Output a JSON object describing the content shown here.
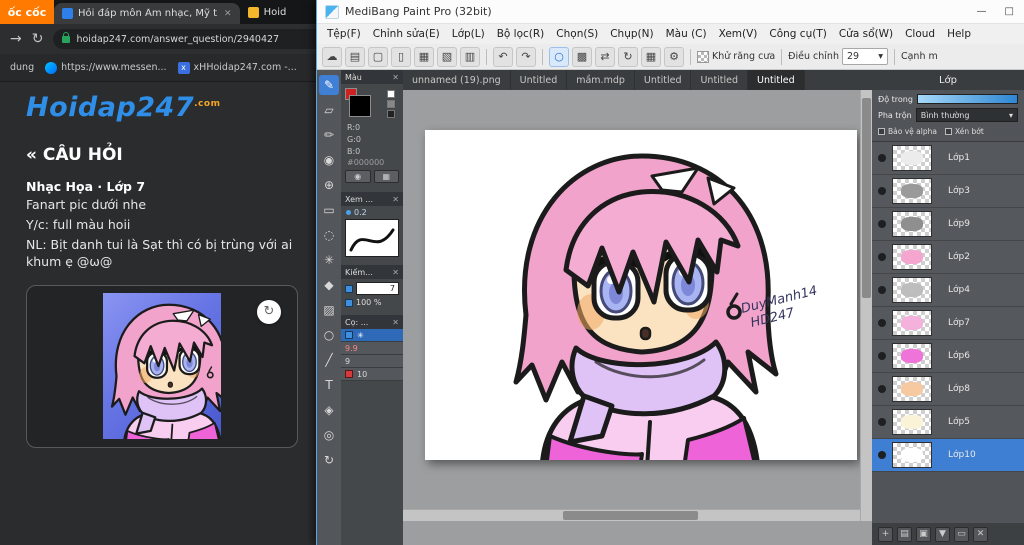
{
  "browser": {
    "brand": "ốc cốc",
    "tabs": [
      {
        "label": "Hỏi đáp môn Âm nhạc, Mỹ t"
      },
      {
        "label": "Hoid"
      }
    ],
    "nav": {
      "url": "hoidap247.com/answer_question/2940427"
    },
    "bookmarks": {
      "item1": "dung",
      "item2": "https://www.messen...",
      "item3": "xHHoidap247.com -..."
    },
    "site": {
      "logo": "Hoidap247",
      "logo_suffix": ".com",
      "heading": "« CÂU HỎI",
      "subject": "Nhạc Họa · Lớp 7",
      "lines": [
        "Fanart pic dưới nhe",
        "Y/c: full màu hoii",
        "NL: Bịt danh tui là Sạt thì có bị trùng với ai khum ẹ @ω@"
      ]
    },
    "icons": {
      "forward": "→",
      "reload": "↻",
      "close_tab": "✕",
      "refresh_image": "↻",
      "x_badge": "x"
    }
  },
  "medibang": {
    "title": "MediBang Paint Pro (32bit)",
    "window_controls": {
      "minimize": "—",
      "maximize": "□"
    },
    "menus": [
      "Tệp(F)",
      "Chỉnh sửa(E)",
      "Lớp(L)",
      "Bộ lọc(R)",
      "Chọn(S)",
      "Chụp(N)",
      "Màu (C)",
      "Xem(V)",
      "Công cụ(T)",
      "Cửa sổ(W)",
      "Cloud",
      "Help"
    ],
    "toolbar": {
      "antialias_label": "Khử răng cưa",
      "adjust_label": "Điều chỉnh",
      "adjust_value": "29",
      "dropdown_arrow": "▾",
      "edge_label": "Cạnh m"
    },
    "icons": {
      "cloud": "☁",
      "panel": "▤",
      "chat": "▢",
      "new_doc": "▯",
      "save": "▦",
      "open": "▧",
      "export": "▥",
      "undo": "↶",
      "redo": "↷",
      "select_circle": "○",
      "checker_mode": "▩",
      "flip": "⇄",
      "rotate": "↻",
      "grid": "▦",
      "gear": "⚙",
      "close": "✕"
    },
    "tool_icons": {
      "brush": "✎",
      "eraser": "▱",
      "pen": "✏",
      "dropper": "◉",
      "move": "⊕",
      "select_rect": "▭",
      "lasso": "◌",
      "wand": "✳",
      "bucket": "◆",
      "gradient": "▨",
      "shape": "○",
      "line": "╱",
      "text": "T",
      "hand": "◈",
      "zoom": "◎",
      "rotate_view": "↻"
    },
    "doc_tabs": [
      {
        "label": "unnamed (19).png"
      },
      {
        "label": "Untitled"
      },
      {
        "label": "mầm.mdp"
      },
      {
        "label": "Untitled"
      },
      {
        "label": "Untitled"
      },
      {
        "label": "Untitled"
      }
    ],
    "panels": {
      "color": {
        "title": "Màu",
        "r": "R:0",
        "g": "G:0",
        "b": "B:0",
        "hex": "#000000"
      },
      "preview": {
        "title": "Xem ...",
        "value": "0.2"
      },
      "size": {
        "title": "Kiếm...",
        "size_value": "7",
        "opacity_value": "100 %"
      },
      "brush": {
        "title": "Cọ: ...",
        "selected_glyph": "✳",
        "items": [
          "9.9",
          "9",
          "10"
        ]
      }
    },
    "layer_footer_icons": {
      "add": "+",
      "folder": "▤",
      "duplicate": "▣",
      "merge": "▼",
      "clear": "▭",
      "delete": "✕"
    },
    "layers_panel": {
      "title": "Lớp",
      "opacity_label": "Độ trong",
      "blend_label": "Pha trộn",
      "blend_value": "Bình thường",
      "alpha_protect_label": "Bảo vệ alpha",
      "clipping_label": "Xén bớt",
      "layers": [
        {
          "name": "Lớp1",
          "thumb": "#ececec"
        },
        {
          "name": "Lớp3",
          "thumb": "#9a9a9a"
        },
        {
          "name": "Lớp9",
          "thumb": "#8f8f8f"
        },
        {
          "name": "Lớp2",
          "thumb": "#f4a6cf"
        },
        {
          "name": "Lớp4",
          "thumb": "#bdbdbd"
        },
        {
          "name": "Lớp7",
          "thumb": "#f3b1dc"
        },
        {
          "name": "Lớp6",
          "thumb": "#ee74da"
        },
        {
          "name": "Lớp8",
          "thumb": "#f6c9a0"
        },
        {
          "name": "Lớp5",
          "thumb": "#fbf3d8"
        },
        {
          "name": "Lớp10",
          "thumb": "#ffffff"
        }
      ]
    },
    "artwork": {
      "signature_line1": "DuyManh14",
      "signature_line2": "HD247",
      "hair_color": "#f2a3cb",
      "skin_color": "#fbe3c2",
      "scarf_color": "#dfc2f6",
      "jacket_light": "#f8cdef",
      "jacket_bright": "#ee64d8"
    }
  }
}
